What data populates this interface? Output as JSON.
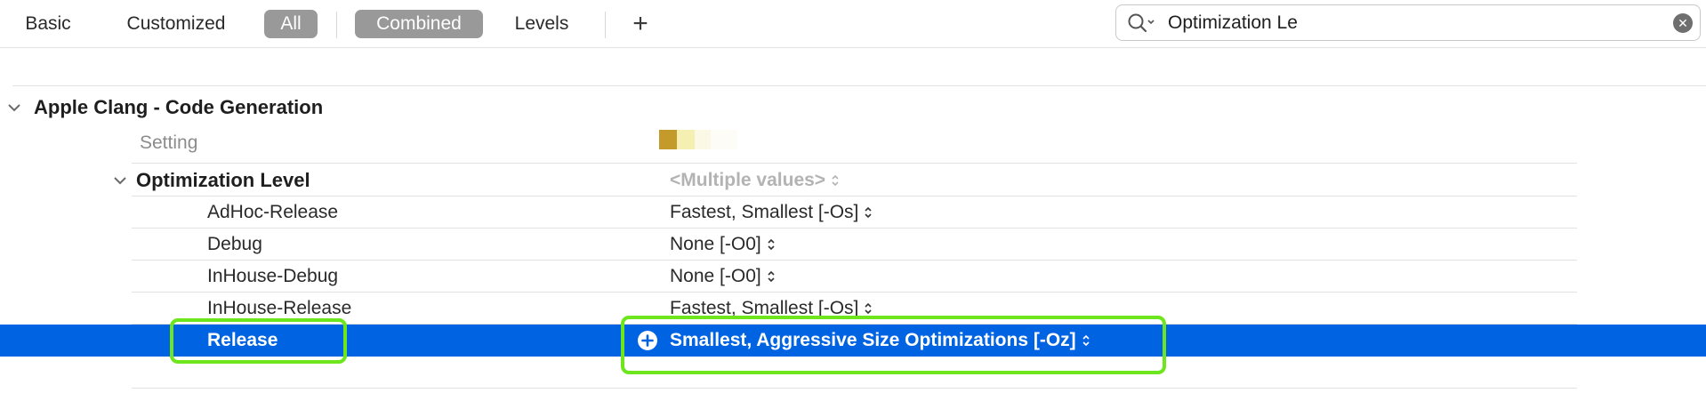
{
  "toolbar": {
    "filters": [
      "Basic",
      "Customized",
      "All"
    ],
    "views": [
      "Combined",
      "Levels"
    ],
    "add_label": "+",
    "selected_filter": "All",
    "selected_view": "Combined"
  },
  "search": {
    "value": "Optimization Le",
    "icons": [
      "magnifier-icon",
      "clear-icon"
    ]
  },
  "group": {
    "title": "Apple Clang - Code Generation",
    "column_setting": "Setting"
  },
  "setting": {
    "name": "Optimization Level",
    "summary": "<Multiple values>",
    "configs": [
      {
        "name": "AdHoc-Release",
        "value": "Fastest, Smallest [-Os]"
      },
      {
        "name": "Debug",
        "value": "None [-O0]"
      },
      {
        "name": "InHouse-Debug",
        "value": "None [-O0]"
      },
      {
        "name": "InHouse-Release",
        "value": "Fastest, Smallest [-Os]"
      },
      {
        "name": "Release",
        "value": "Smallest, Aggressive Size Optimizations [-Oz]",
        "selected": true
      }
    ]
  },
  "colors": {
    "selection": "#0063e1",
    "highlight": "#6ee61e",
    "pill": "#999999"
  }
}
